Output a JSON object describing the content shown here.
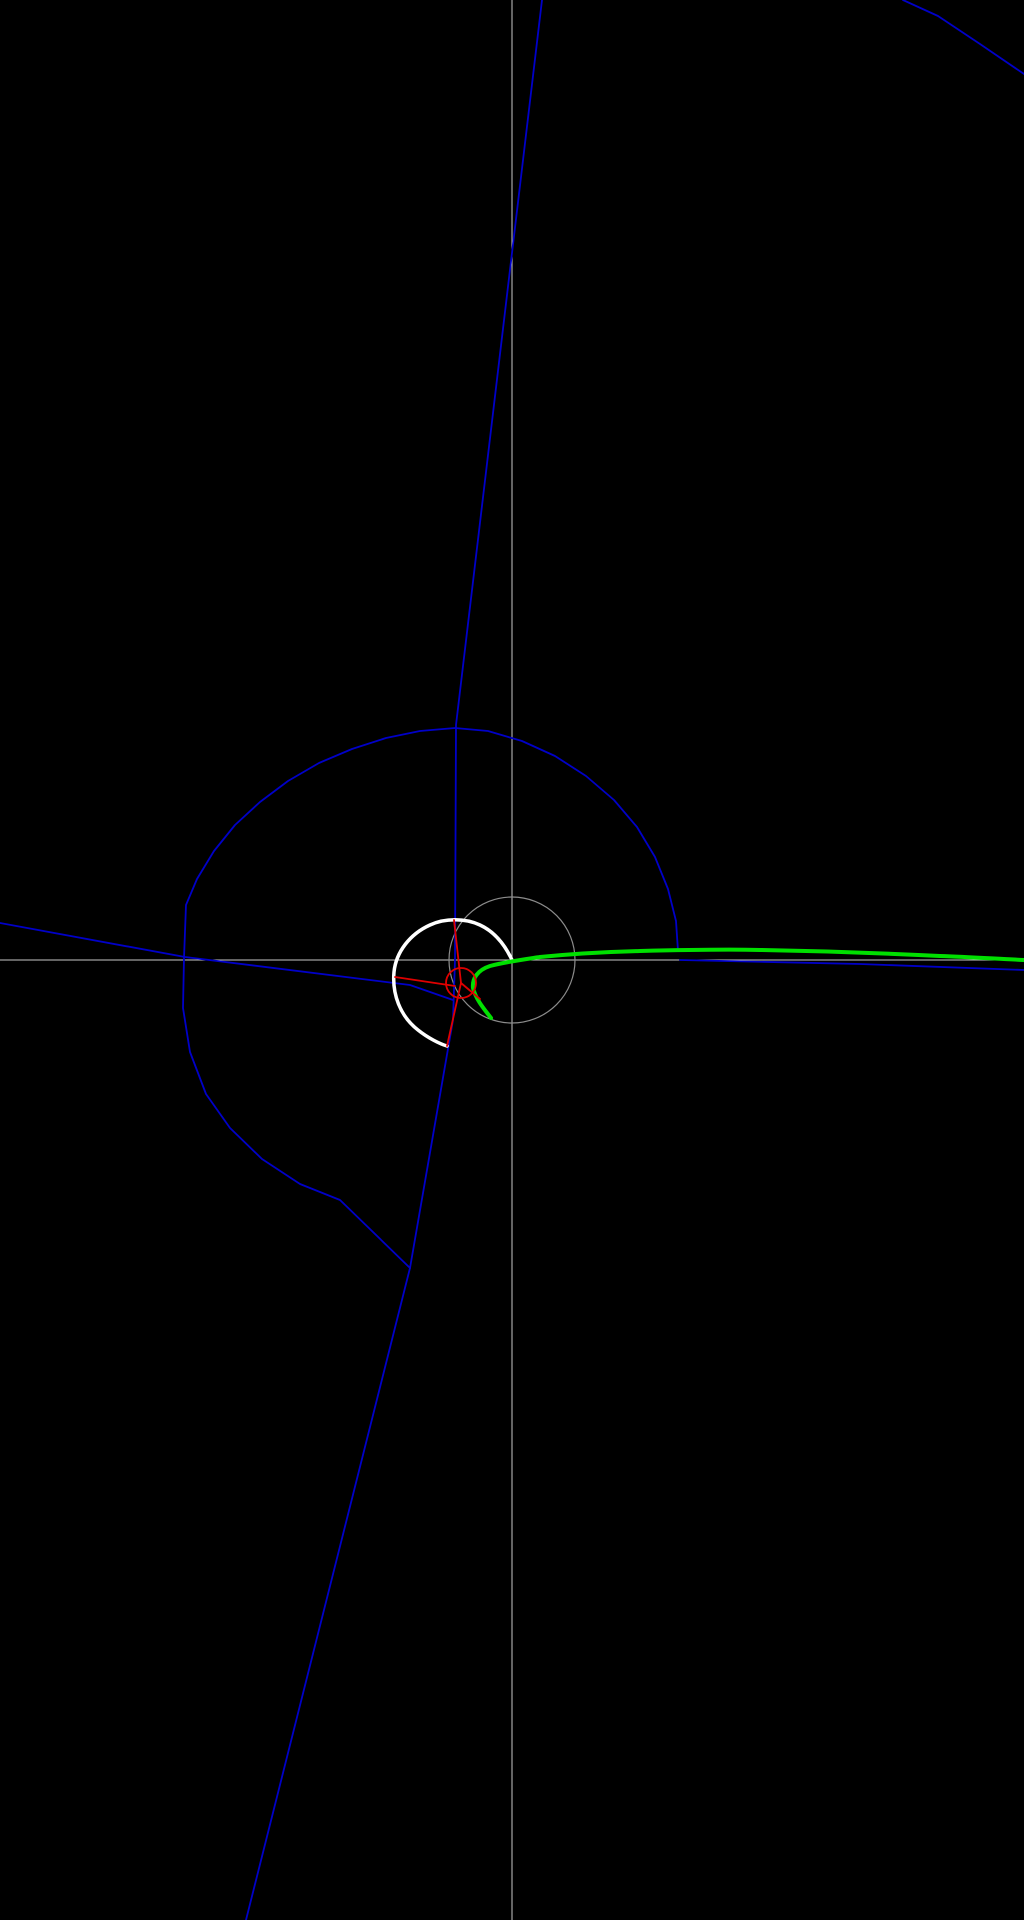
{
  "scene": {
    "background_color": "#000000",
    "crosshair_color": "#c8c8c8",
    "reference_circle_color": "#8c8c8c",
    "spiral_color": "#0000c8",
    "inner_curve_color": "#ffffff",
    "tail_curve_color": "#00e000",
    "marker_color": "#e00000"
  },
  "elements": {
    "crosshair": "crosshair",
    "reference_circle": "reference-circle",
    "blue_spiral": "blue-spiral",
    "white_arc": "white-arc",
    "green_tail": "green-tail",
    "red_markers": "red-markers"
  }
}
